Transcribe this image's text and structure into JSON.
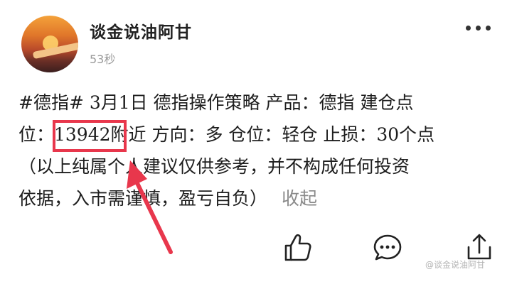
{
  "header": {
    "author_name": "谈金说油阿甘",
    "post_time": "53秒"
  },
  "post": {
    "lines": [
      "#德指# 3月1日 德指操作策略 产品：德指 建仓点",
      "位：13942附近 方向：多 仓位：轻仓 止损：30个点",
      "（以上纯属个人建议仅供参考，并不构成任何投资",
      "依据，入市需谨慎，盈亏自负）"
    ],
    "collapse_label": "收起",
    "highlighted_value": "13942"
  },
  "actions": {
    "like_icon": "thumbs-up-icon",
    "comment_icon": "comment-icon",
    "share_icon": "share-icon"
  },
  "watermark": "@谈金说油阿甘",
  "colors": {
    "highlight": "#e8374c",
    "arrow": "#e8374c",
    "muted_text": "#8a8a8a"
  }
}
